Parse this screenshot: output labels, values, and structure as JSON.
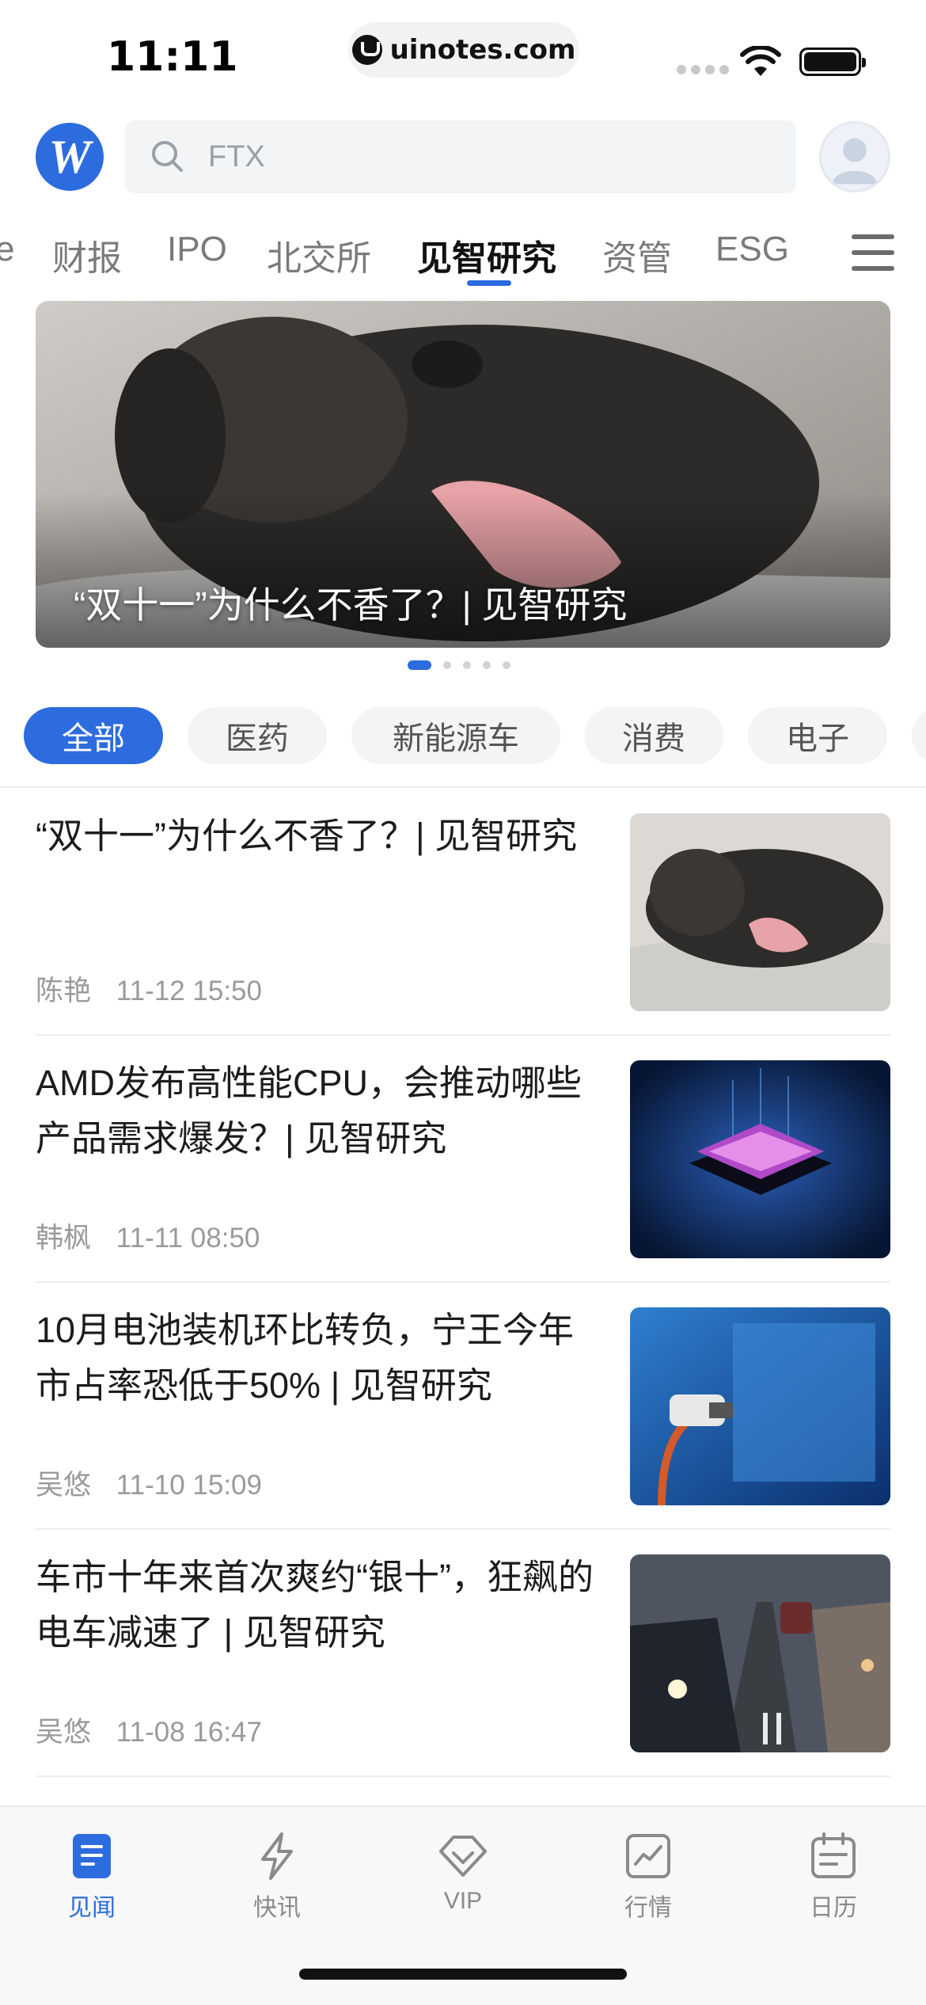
{
  "status_bar": {
    "time": "11:11",
    "url": "uinotes.com"
  },
  "search": {
    "placeholder": "FTX"
  },
  "channels": [
    {
      "label": "e"
    },
    {
      "label": "财报"
    },
    {
      "label": "IPO"
    },
    {
      "label": "北交所"
    },
    {
      "label": "见智研究",
      "active": true
    },
    {
      "label": "资管"
    },
    {
      "label": "ESG"
    }
  ],
  "banner": {
    "title": "“双十一”为什么不香了？| 见智研究",
    "slide_count": 5,
    "active_slide": 1
  },
  "filters": [
    {
      "label": "全部",
      "active": true
    },
    {
      "label": "医药"
    },
    {
      "label": "新能源车"
    },
    {
      "label": "消费"
    },
    {
      "label": "电子"
    }
  ],
  "articles": [
    {
      "title": "“双十一”为什么不香了？| 见智研究",
      "author": "陈艳",
      "time": "11-12 15:50",
      "thumb": "dog-yawning"
    },
    {
      "title": "AMD发布高性能CPU，会推动哪些产品需求爆发？| 见智研究",
      "author": "韩枫",
      "time": "11-11 08:50",
      "thumb": "glowing-chip"
    },
    {
      "title": "10月电池装机环比转负，宁王今年市占率恐低于50% | 见智研究",
      "author": "吴悠",
      "time": "11-10 15:09",
      "thumb": "ev-charger"
    },
    {
      "title": "车市十年来首次爽约“银十”，狂飙的电车减速了 | 见智研究",
      "author": "吴悠",
      "time": "11-08 16:47",
      "thumb": "traffic-street"
    }
  ],
  "bottom_nav": [
    {
      "label": "见闻",
      "icon": "news-doc-icon",
      "active": true
    },
    {
      "label": "快讯",
      "icon": "lightning-icon"
    },
    {
      "label": "VIP",
      "icon": "diamond-icon"
    },
    {
      "label": "行情",
      "icon": "chart-icon"
    },
    {
      "label": "日历",
      "icon": "calendar-icon"
    }
  ],
  "colors": {
    "accent": "#2d6cdf",
    "text": "#1c1c1c",
    "muted": "#9a9a9a"
  }
}
